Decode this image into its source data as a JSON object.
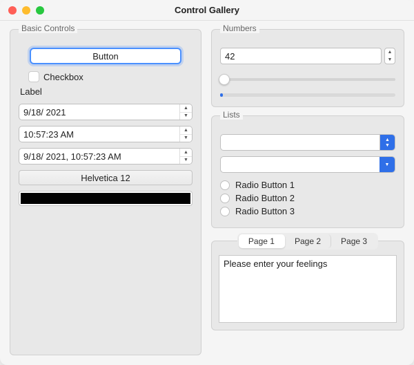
{
  "window": {
    "title": "Control Gallery"
  },
  "basic": {
    "legend": "Basic Controls",
    "button_label": "Button",
    "checkbox_label": "Checkbox",
    "label_text": "Label",
    "date_value": "9/18/ 2021",
    "time_value": "10:57:23 AM",
    "datetime_value": "9/18/ 2021, 10:57:23 AM",
    "font_button_label": "Helvetica 12",
    "color_hex": "#000000"
  },
  "numbers": {
    "legend": "Numbers",
    "spinbox_value": "42",
    "slider_value": 0,
    "progress_value": 1
  },
  "lists": {
    "legend": "Lists",
    "combobox_value": "",
    "editable_value": "",
    "radios": [
      "Radio Button 1",
      "Radio Button 2",
      "Radio Button 3"
    ]
  },
  "tabs": {
    "labels": [
      "Page 1",
      "Page 2",
      "Page 3"
    ],
    "active_index": 0,
    "entry_value": "Please enter your feelings"
  }
}
